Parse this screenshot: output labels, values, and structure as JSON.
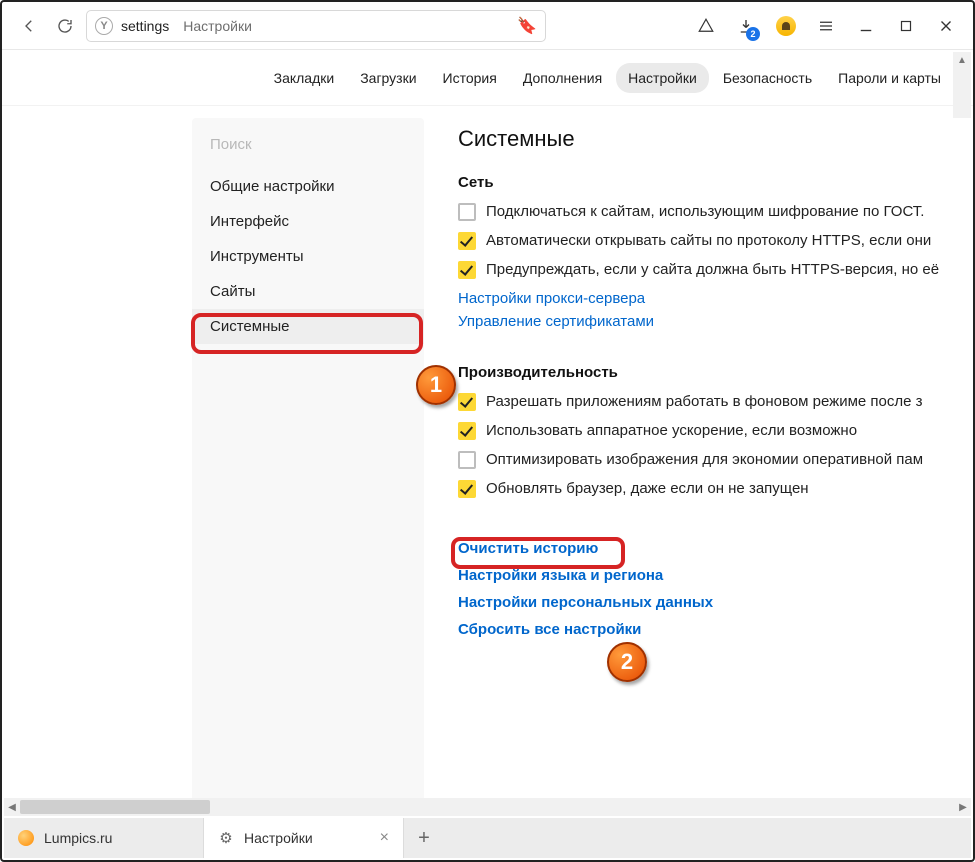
{
  "chrome": {
    "address_main": "settings",
    "address_title": "Настройки",
    "download_badge": "2"
  },
  "tabs": {
    "items": [
      "Закладки",
      "Загрузки",
      "История",
      "Дополнения",
      "Настройки",
      "Безопасность",
      "Пароли и карты"
    ],
    "active_index": 4
  },
  "sidebar": {
    "search_placeholder": "Поиск",
    "items": [
      "Общие настройки",
      "Интерфейс",
      "Инструменты",
      "Сайты",
      "Системные"
    ],
    "active_index": 4
  },
  "content": {
    "title": "Системные",
    "network": {
      "heading": "Сеть",
      "opts": [
        {
          "checked": false,
          "label": "Подключаться к сайтам, использующим шифрование по ГОСТ."
        },
        {
          "checked": true,
          "label": "Автоматически открывать сайты по протоколу HTTPS, если они"
        },
        {
          "checked": true,
          "label": "Предупреждать, если у сайта должна быть HTTPS-версия, но её"
        }
      ],
      "links": [
        "Настройки прокси-сервера",
        "Управление сертификатами"
      ]
    },
    "perf": {
      "heading": "Производительность",
      "opts": [
        {
          "checked": true,
          "label": "Разрешать приложениям работать в фоновом режиме после з"
        },
        {
          "checked": true,
          "label": "Использовать аппаратное ускорение, если возможно"
        },
        {
          "checked": false,
          "label": "Оптимизировать изображения для экономии оперативной пам"
        },
        {
          "checked": true,
          "label": "Обновлять браузер, даже если он не запущен"
        }
      ]
    },
    "actions": [
      "Очистить историю",
      "Настройки языка и региона",
      "Настройки персональных данных",
      "Сбросить все настройки"
    ]
  },
  "tabstrip": {
    "tabs": [
      {
        "title": "Lumpics.ru",
        "active": false
      },
      {
        "title": "Настройки",
        "active": true
      }
    ]
  },
  "markers": {
    "one": "1",
    "two": "2"
  }
}
